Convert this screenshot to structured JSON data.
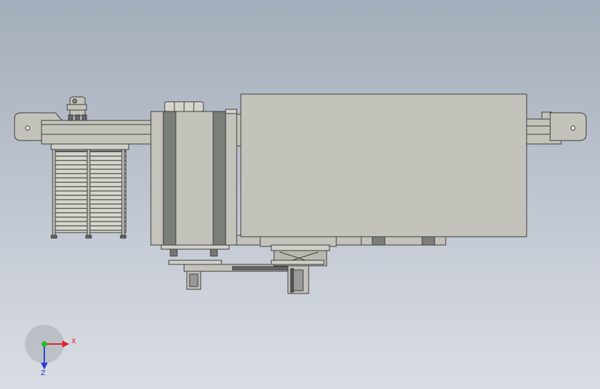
{
  "triad": {
    "x_label": "X",
    "y_label": "Y",
    "z_label": "Z",
    "x_color": "#e0202a",
    "y_color": "#1fbf2a",
    "z_color": "#2a3fd6"
  },
  "model": {
    "body_color": "#c3c3bb",
    "outline_color": "#3a3a3a",
    "dark_band_color": "#7c7f78",
    "bg_top": "#a4adbb",
    "bg_bottom": "#dadde3"
  }
}
